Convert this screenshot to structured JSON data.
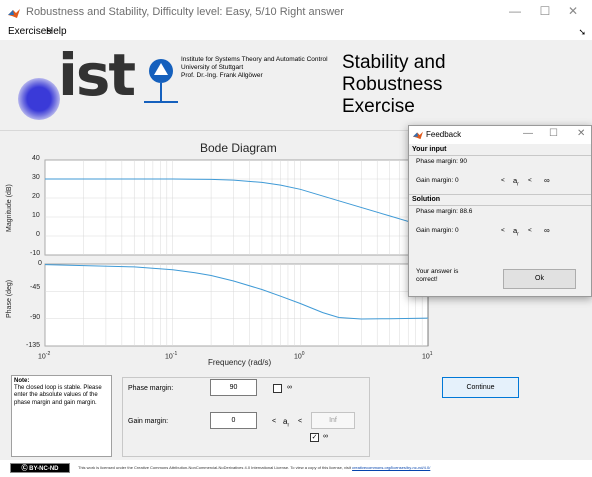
{
  "window": {
    "title": "Robustness and Stability, Difficulty level: Easy, 5/10 Right answer",
    "minimize": "—",
    "maximize": "☐",
    "close": "✕"
  },
  "menu": {
    "items": [
      "Exercises",
      "Help"
    ],
    "overflow_arrow": "➘"
  },
  "header": {
    "logo_text": "ist",
    "institute": [
      "Institute for Systems Theory and Automatic Control",
      "University of Stuttgart",
      "Prof. Dr.-Ing. Frank Allgöwer"
    ],
    "title_lines": [
      "Stability and",
      "Robustness",
      "Exercise"
    ]
  },
  "plot": {
    "title": "Bode Diagram",
    "ylabel_mag": "Magnitude (dB)",
    "ylabel_phase": "Phase (deg)",
    "xlabel": "Frequency  (rad/s)",
    "mag_ticks": [
      "40",
      "30",
      "20",
      "10",
      "0",
      "-10"
    ],
    "phase_ticks": [
      "0",
      "-45",
      "-90",
      "-135"
    ],
    "x_ticks": [
      "10",
      "10",
      "10",
      "10"
    ],
    "x_exps": [
      "-2",
      "-1",
      "0",
      "1"
    ]
  },
  "chart_data": [
    {
      "type": "line",
      "title": "Bode Diagram",
      "ylabel": "Magnitude (dB)",
      "xscale": "log",
      "xlim": [
        0.01,
        10
      ],
      "ylim": [
        -10,
        40
      ],
      "grid": true,
      "x": [
        0.01,
        0.05,
        0.1,
        0.15,
        0.2,
        0.3,
        0.5,
        0.7,
        1,
        2,
        5,
        10
      ],
      "values": [
        30,
        30,
        30,
        29.9,
        29.8,
        29.4,
        28.2,
        26.8,
        24.6,
        18.5,
        10.6,
        4.6
      ]
    },
    {
      "type": "line",
      "ylabel": "Phase (deg)",
      "xlabel": "Frequency  (rad/s)",
      "xscale": "log",
      "xlim": [
        0.01,
        10
      ],
      "ylim": [
        -135,
        0
      ],
      "grid": true,
      "x": [
        0.01,
        0.05,
        0.1,
        0.15,
        0.2,
        0.3,
        0.5,
        0.7,
        1,
        1.5,
        2,
        3,
        5,
        10
      ],
      "values": [
        -1,
        -4.8,
        -9.5,
        -14.3,
        -19,
        -28,
        -42,
        -53,
        -65,
        -80,
        -88,
        -90.5,
        -90,
        -89
      ]
    }
  ],
  "note": {
    "heading": "Note:",
    "body": "The closed loop is stable. Please enter the absolute values of the phase margin and gain margin."
  },
  "inputs": {
    "phase_label": "Phase margin:",
    "phase_value": "90",
    "phase_inf": "∞",
    "gain_label": "Gain margin:",
    "gain_value": "0",
    "lt": "<",
    "ar": "a",
    "ar_sub": "r",
    "upper_value": "Inf",
    "gain_inf": "∞",
    "gain_check": "✓"
  },
  "continue_label": "Continue",
  "footer": {
    "badge": "BY-NC-ND",
    "license_text": "This work is licensed under the Creative Commons Attribution-NonCommercial-NoDerivatives 4.0 International License. To view a copy of this license, visit",
    "license_link": "creativecommons.org/licenses/by-nc-nd/4.0/"
  },
  "feedback": {
    "title": "Feedback",
    "your_input": "Your input",
    "in_phase": "Phase margin: 90",
    "in_gain": "Gain margin: 0",
    "solution": "Solution",
    "sol_phase": "Phase margin: 88.6",
    "sol_gain": "Gain margin: 0",
    "lt": "<",
    "ar": "a",
    "ar_sub": "r",
    "inf": "∞",
    "result": [
      "Your answer is",
      "correct!"
    ],
    "ok_label": "Ok"
  },
  "colors": {
    "curve": "#3f9ad6",
    "accent": "#0078d7",
    "logo_blue": "#1560bd"
  }
}
